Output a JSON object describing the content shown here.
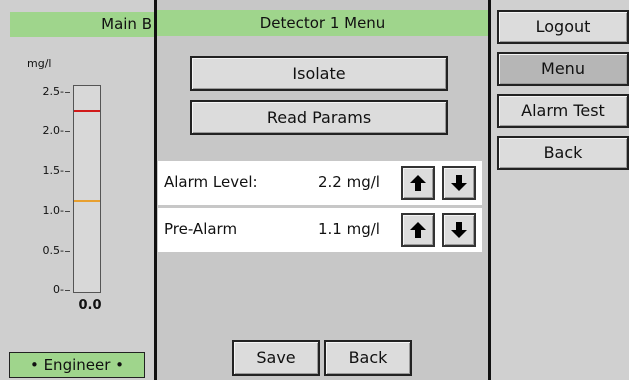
{
  "main": {
    "header_title": "Main B",
    "unit": "mg/l",
    "ticks": [
      "2.5-",
      "2.0-",
      "1.5-",
      "1.0-",
      "0.5-",
      "0-"
    ],
    "gauge_value": "0.0",
    "gauge_scale_max": 2.5,
    "alarm_line_value": 2.2,
    "prealarm_line_value": 1.1,
    "alarm_line_color": "#d11a1a",
    "prealarm_line_color": "#e8a030",
    "role": "• Engineer •"
  },
  "dialog": {
    "title": "Detector 1 Menu",
    "isolate_label": "Isolate",
    "read_params_label": "Read Params",
    "alarm_level": {
      "label": "Alarm Level:",
      "value": "2.2 mg/l"
    },
    "pre_alarm": {
      "label": "Pre-Alarm",
      "value": "1.1 mg/l"
    },
    "save_label": "Save",
    "back_label": "Back"
  },
  "side_menu": {
    "logout": "Logout",
    "menu": "Menu",
    "alarm_test": "Alarm Test",
    "back": "Back"
  },
  "colors": {
    "header_green": "#9fd58c"
  },
  "icons": {
    "up": "arrow-up-icon",
    "down": "arrow-down-icon"
  }
}
